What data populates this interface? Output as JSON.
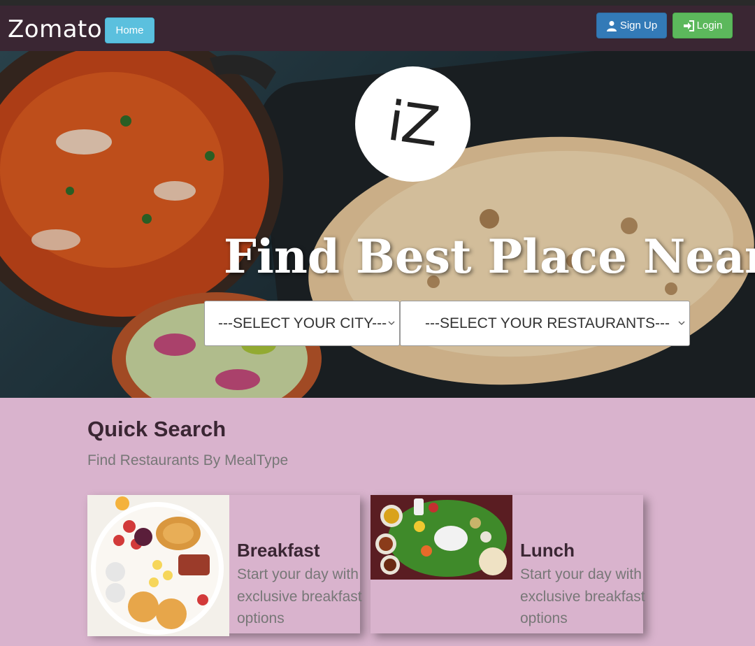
{
  "navbar": {
    "brand": "Zomato",
    "home_label": "Home",
    "signup_label": "Sign Up",
    "login_label": "Login"
  },
  "hero": {
    "logo_text": "iZ",
    "title": "Find Best Place Near",
    "city_select": "---SELECT YOUR CITY---",
    "restaurant_select": "---SELECT YOUR RESTAURANTS---"
  },
  "quick_search": {
    "title": "Quick Search",
    "subtitle": "Find Restaurants By MealType",
    "cards": [
      {
        "title": "Breakfast",
        "description": "Start your day with exclusive breakfast options"
      },
      {
        "title": "Lunch",
        "description": "Start your day with exclusive breakfast options"
      }
    ]
  },
  "colors": {
    "navbar": "#3a2633",
    "page_background": "#d9b3cd",
    "home_button": "#5bc0de",
    "signup_button": "#337ab7",
    "login_button": "#5cb85c"
  },
  "icons": [
    "user-icon",
    "login-icon",
    "chevron-down-icon"
  ]
}
